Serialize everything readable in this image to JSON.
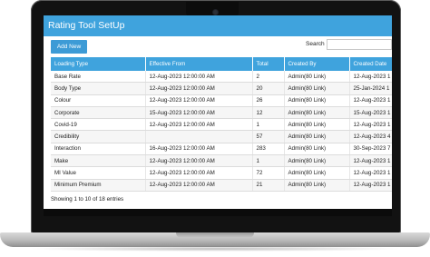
{
  "app": {
    "title": "Rating Tool SetUp"
  },
  "toolbar": {
    "add_label": "Add New",
    "search_label": "Search",
    "search_value": ""
  },
  "table": {
    "columns": [
      "Loading Type",
      "Effective From",
      "Total",
      "Created By",
      "Created Date"
    ],
    "rows": [
      [
        "Base Rate",
        "12-Aug-2023 12:00:00 AM",
        "2",
        "Admin(80 Link)",
        "12-Aug-2023 1"
      ],
      [
        "Body Type",
        "12-Aug-2023 12:00:00 AM",
        "20",
        "Admin(80 Link)",
        "25-Jan-2024 1"
      ],
      [
        "Colour",
        "12-Aug-2023 12:00:00 AM",
        "26",
        "Admin(80 Link)",
        "12-Aug-2023 1"
      ],
      [
        "Corporate",
        "15-Aug-2023 12:00:00 AM",
        "12",
        "Admin(80 Link)",
        "15-Aug-2023 1"
      ],
      [
        "Covid-19",
        "12-Aug-2023 12:00:00 AM",
        "1",
        "Admin(80 Link)",
        "12-Aug-2023 1"
      ],
      [
        "Credibility",
        "",
        "57",
        "Admin(80 Link)",
        "12-Aug-2023 4"
      ],
      [
        "Interaction",
        "16-Aug-2023 12:00:00 AM",
        "283",
        "Admin(80 Link)",
        "30-Sep-2023 7"
      ],
      [
        "Make",
        "12-Aug-2023 12:00:00 AM",
        "1",
        "Admin(80 Link)",
        "12-Aug-2023 1"
      ],
      [
        "MI Value",
        "12-Aug-2023 12:00:00 AM",
        "72",
        "Admin(80 Link)",
        "12-Aug-2023 1"
      ],
      [
        "Minimum Premium",
        "12-Aug-2023 12:00:00 AM",
        "21",
        "Admin(80 Link)",
        "12-Aug-2023 1"
      ]
    ]
  },
  "footer": {
    "info": "Showing 1 to 10 of 18 entries"
  },
  "colors": {
    "accent": "#3fa3dd",
    "button": "#3d9bd6",
    "bezel": "#121212"
  }
}
